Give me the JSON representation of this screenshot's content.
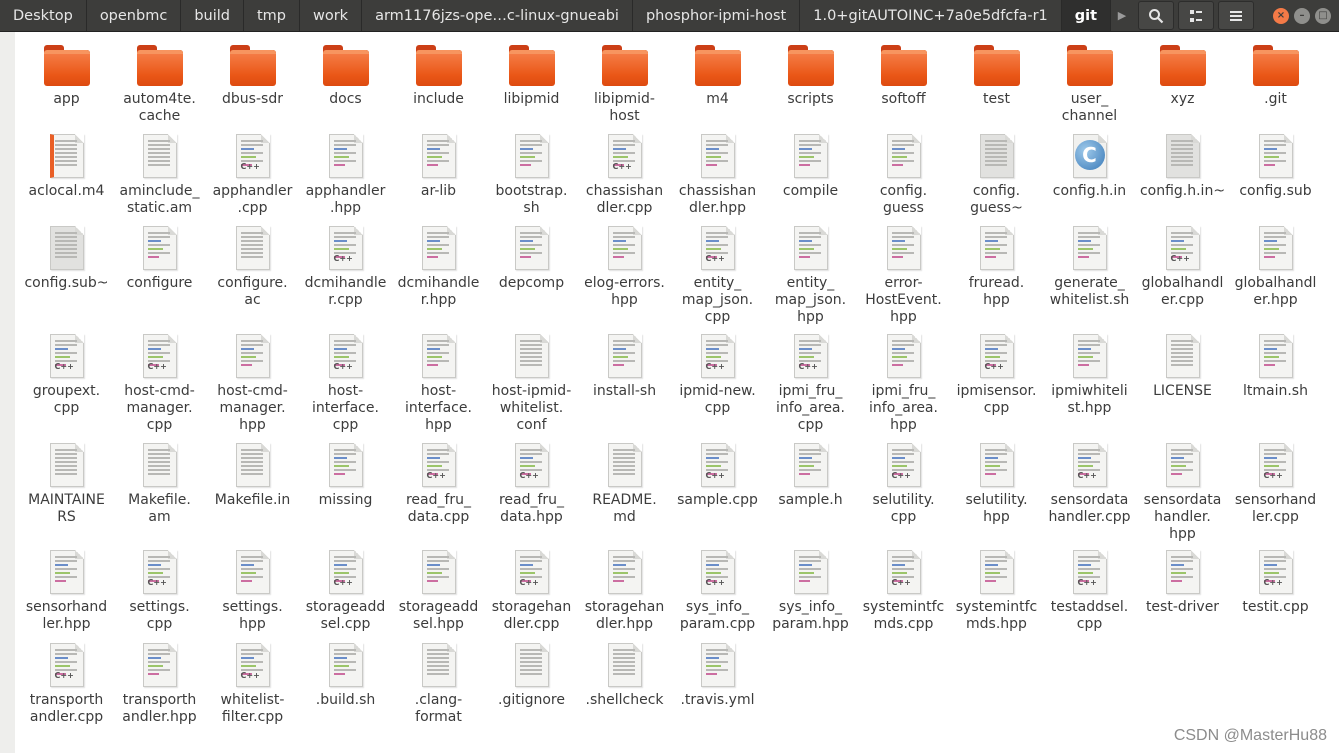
{
  "breadcrumbs": [
    "Desktop",
    "openbmc",
    "build",
    "tmp",
    "work",
    "arm1176jzs-ope…c-linux-gnueabi",
    "phosphor-ipmi-host",
    "1.0+gitAUTOINC+7a0e5dfcfa-r1",
    "git"
  ],
  "toolbar": {
    "search_icon": "search-icon",
    "view_icon": "view-options-icon",
    "menu_icon": "menu-icon"
  },
  "colors": {
    "header_bg": "#3d3d3b",
    "folder": "#ea5717",
    "close": "#f47a47"
  },
  "watermark": "CSDN @MasterHu88",
  "files": [
    {
      "name": "app",
      "type": "folder"
    },
    {
      "name": "autom4te.\ncache",
      "type": "folder"
    },
    {
      "name": "dbus-sdr",
      "type": "folder"
    },
    {
      "name": "docs",
      "type": "folder"
    },
    {
      "name": "include",
      "type": "folder"
    },
    {
      "name": "libipmid",
      "type": "folder"
    },
    {
      "name": "libipmid-\nhost",
      "type": "folder"
    },
    {
      "name": "m4",
      "type": "folder"
    },
    {
      "name": "scripts",
      "type": "folder"
    },
    {
      "name": "softoff",
      "type": "folder"
    },
    {
      "name": "test",
      "type": "folder"
    },
    {
      "name": "user_\nchannel",
      "type": "folder"
    },
    {
      "name": "xyz",
      "type": "folder"
    },
    {
      "name": ".git",
      "type": "folder"
    },
    {
      "name": "aclocal.m4",
      "type": "doc-orange"
    },
    {
      "name": "aminclude_\nstatic.am",
      "type": "doc"
    },
    {
      "name": "apphandler\n.cpp",
      "type": "cpp"
    },
    {
      "name": "apphandler\n.hpp",
      "type": "code"
    },
    {
      "name": "ar-lib",
      "type": "code"
    },
    {
      "name": "bootstrap.\nsh",
      "type": "code"
    },
    {
      "name": "chassishan\ndler.cpp",
      "type": "cpp"
    },
    {
      "name": "chassishan\ndler.hpp",
      "type": "code"
    },
    {
      "name": "compile",
      "type": "code"
    },
    {
      "name": "config.\nguess",
      "type": "code"
    },
    {
      "name": "config.\nguess~",
      "type": "gray"
    },
    {
      "name": "config.h.in",
      "type": "c"
    },
    {
      "name": "config.h.in~",
      "type": "gray"
    },
    {
      "name": "config.sub",
      "type": "code"
    },
    {
      "name": "config.sub~",
      "type": "gray"
    },
    {
      "name": "configure",
      "type": "code"
    },
    {
      "name": "configure.\nac",
      "type": "doc"
    },
    {
      "name": "dcmihandle\nr.cpp",
      "type": "cpp"
    },
    {
      "name": "dcmihandle\nr.hpp",
      "type": "code"
    },
    {
      "name": "depcomp",
      "type": "code"
    },
    {
      "name": "elog-errors.\nhpp",
      "type": "code"
    },
    {
      "name": "entity_\nmap_json.\ncpp",
      "type": "cpp"
    },
    {
      "name": "entity_\nmap_json.\nhpp",
      "type": "code"
    },
    {
      "name": "error-\nHostEvent.\nhpp",
      "type": "code"
    },
    {
      "name": "fruread.\nhpp",
      "type": "code"
    },
    {
      "name": "generate_\nwhitelist.sh",
      "type": "code"
    },
    {
      "name": "globalhandl\ner.cpp",
      "type": "cpp"
    },
    {
      "name": "globalhandl\ner.hpp",
      "type": "code"
    },
    {
      "name": "groupext.\ncpp",
      "type": "cpp"
    },
    {
      "name": "host-cmd-\nmanager.\ncpp",
      "type": "cpp"
    },
    {
      "name": "host-cmd-\nmanager.\nhpp",
      "type": "code"
    },
    {
      "name": "host-\ninterface.\ncpp",
      "type": "cpp"
    },
    {
      "name": "host-\ninterface.\nhpp",
      "type": "code"
    },
    {
      "name": "host-ipmid-\nwhitelist.\nconf",
      "type": "doc"
    },
    {
      "name": "install-sh",
      "type": "code"
    },
    {
      "name": "ipmid-new.\ncpp",
      "type": "cpp"
    },
    {
      "name": "ipmi_fru_\ninfo_area.\ncpp",
      "type": "cpp"
    },
    {
      "name": "ipmi_fru_\ninfo_area.\nhpp",
      "type": "code"
    },
    {
      "name": "ipmisensor.\ncpp",
      "type": "cpp"
    },
    {
      "name": "ipmiwhiteli\nst.hpp",
      "type": "code"
    },
    {
      "name": "LICENSE",
      "type": "doc"
    },
    {
      "name": "ltmain.sh",
      "type": "code"
    },
    {
      "name": "MAINTAINE\nRS",
      "type": "doc"
    },
    {
      "name": "Makefile.\nam",
      "type": "doc"
    },
    {
      "name": "Makefile.in",
      "type": "doc"
    },
    {
      "name": "missing",
      "type": "code"
    },
    {
      "name": "read_fru_\ndata.cpp",
      "type": "cpp"
    },
    {
      "name": "read_fru_\ndata.hpp",
      "type": "cpp"
    },
    {
      "name": "README.\nmd",
      "type": "doc"
    },
    {
      "name": "sample.cpp",
      "type": "cpp"
    },
    {
      "name": "sample.h",
      "type": "code"
    },
    {
      "name": "selutility.\ncpp",
      "type": "cpp"
    },
    {
      "name": "selutility.\nhpp",
      "type": "code"
    },
    {
      "name": "sensordata\nhandler.cpp",
      "type": "cpp"
    },
    {
      "name": "sensordata\nhandler.\nhpp",
      "type": "code"
    },
    {
      "name": "sensorhand\nler.cpp",
      "type": "cpp"
    },
    {
      "name": "sensorhand\nler.hpp",
      "type": "code"
    },
    {
      "name": "settings.\ncpp",
      "type": "cpp"
    },
    {
      "name": "settings.\nhpp",
      "type": "code"
    },
    {
      "name": "storageadd\nsel.cpp",
      "type": "cpp"
    },
    {
      "name": "storageadd\nsel.hpp",
      "type": "code"
    },
    {
      "name": "storagehan\ndler.cpp",
      "type": "cpp"
    },
    {
      "name": "storagehan\ndler.hpp",
      "type": "code"
    },
    {
      "name": "sys_info_\nparam.cpp",
      "type": "cpp"
    },
    {
      "name": "sys_info_\nparam.hpp",
      "type": "code"
    },
    {
      "name": "systemintfc\nmds.cpp",
      "type": "cpp"
    },
    {
      "name": "systemintfc\nmds.hpp",
      "type": "code"
    },
    {
      "name": "testaddsel.\ncpp",
      "type": "cpp"
    },
    {
      "name": "test-driver",
      "type": "code"
    },
    {
      "name": "testit.cpp",
      "type": "cpp"
    },
    {
      "name": "transporth\nandler.cpp",
      "type": "cpp"
    },
    {
      "name": "transporth\nandler.hpp",
      "type": "code"
    },
    {
      "name": "whitelist-\nfilter.cpp",
      "type": "cpp"
    },
    {
      "name": ".build.sh",
      "type": "code"
    },
    {
      "name": ".clang-\nformat",
      "type": "doc"
    },
    {
      "name": ".gitignore",
      "type": "doc"
    },
    {
      "name": ".shellcheck",
      "type": "doc"
    },
    {
      "name": ".travis.yml",
      "type": "code"
    }
  ]
}
